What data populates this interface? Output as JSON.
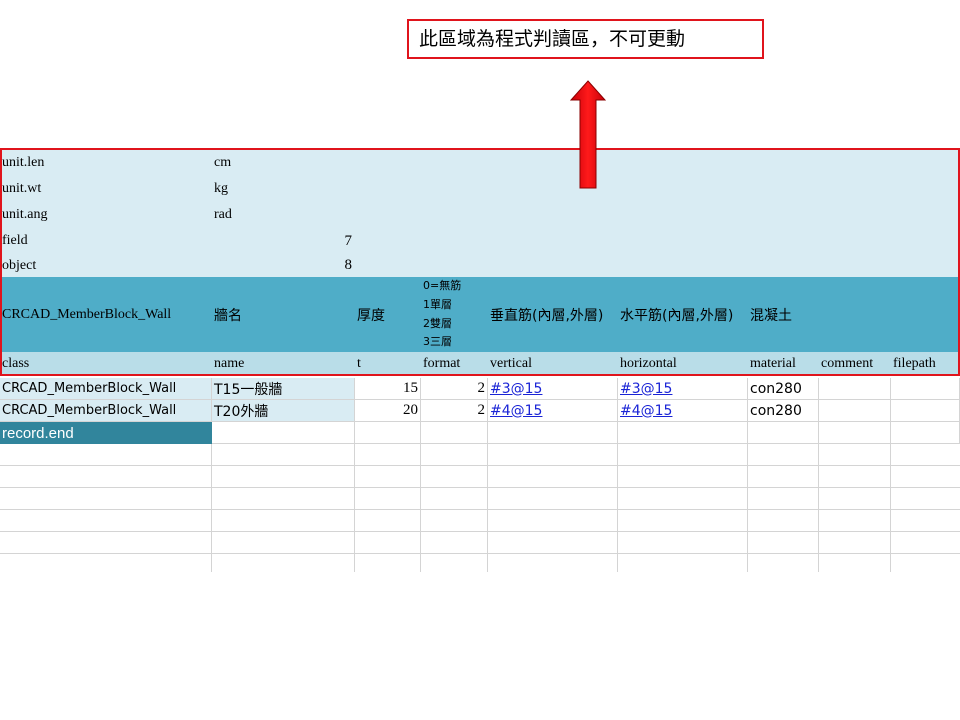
{
  "callout": {
    "text": "此區域為程式判讀區，不可更動"
  },
  "meta_rows": [
    {
      "key": "unit.len",
      "value": "cm",
      "num": ""
    },
    {
      "key": "unit.wt",
      "value": "kg",
      "num": ""
    },
    {
      "key": "unit.ang",
      "value": "rad",
      "num": ""
    },
    {
      "key": "field",
      "value": "",
      "num": "7"
    },
    {
      "key": "object",
      "value": "",
      "num": "8"
    }
  ],
  "header_cn": {
    "class": "CRCAD_MemberBlock_Wall",
    "name": "牆名",
    "t": "厚度",
    "format_lines": [
      "0=無筋",
      "1單層",
      "2雙層",
      "3三層"
    ],
    "vertical": "垂直筋(內層,外層)",
    "horizontal": "水平筋(內層,外層)",
    "material": "混凝土"
  },
  "header_en": [
    "class",
    "name",
    "t",
    "format",
    "vertical",
    "horizontal",
    "material",
    "comment",
    "filepath"
  ],
  "records": [
    {
      "class": "CRCAD_MemberBlock_Wall",
      "name": "T15一般牆",
      "t": "15",
      "format": "2",
      "vertical": "#3@15",
      "horizontal": "#3@15",
      "material": "con280"
    },
    {
      "class": "CRCAD_MemberBlock_Wall",
      "name": "T20外牆",
      "t": "20",
      "format": "2",
      "vertical": "#4@15",
      "horizontal": "#4@15",
      "material": "con280"
    }
  ],
  "record_end": "record.end"
}
